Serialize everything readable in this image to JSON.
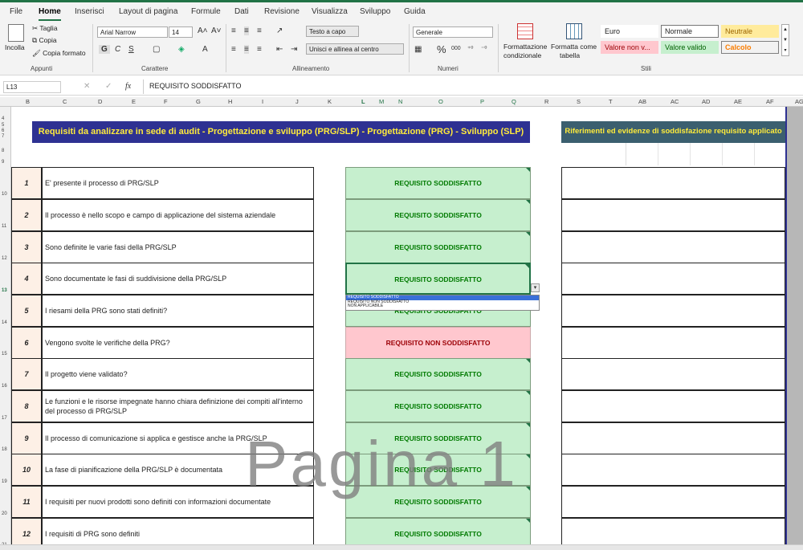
{
  "menu": [
    "File",
    "Home",
    "Inserisci",
    "Layout di pagina",
    "Formule",
    "Dati",
    "Revisione",
    "Visualizza",
    "Sviluppo",
    "Guida"
  ],
  "ribbon": {
    "paste": "Incolla",
    "cut": "Taglia",
    "copy": "Copia",
    "format_painter": "Copia formato",
    "group_clipboard": "Appunti",
    "font_name": "Arial Narrow",
    "font_size": "14",
    "bold": "G",
    "italic": "C",
    "underline": "S",
    "group_font": "Carattere",
    "wrap_text": "Testo a capo",
    "merge_center": "Unisci e allinea al centro",
    "group_alignment": "Allineamento",
    "number_format": "Generale",
    "group_number": "Numeri",
    "cond_format_1": "Formattazione",
    "cond_format_2": "condizionale",
    "format_table_1": "Formatta come",
    "format_table_2": "tabella",
    "styles": {
      "euro": "Euro",
      "normale": "Normale",
      "neutrale": "Neutrale",
      "non_valido": "Valore non v...",
      "valido": "Valore valido",
      "calcolo": "Calcolo"
    },
    "group_styles": "Stili"
  },
  "formula_bar": {
    "name_box": "L13",
    "fx": "fx",
    "value": "REQUISITO SODDISFATTO"
  },
  "columns": [
    "B",
    "C",
    "D",
    "E",
    "F",
    "G",
    "H",
    "I",
    "J",
    "K",
    "L",
    "M",
    "N",
    "O",
    "P",
    "Q",
    "R",
    "S",
    "T",
    "AB",
    "AC",
    "AD",
    "AE",
    "AF",
    "AG"
  ],
  "row_numbers": [
    "4",
    "5",
    "6",
    "7",
    "8",
    "9",
    "10",
    "11",
    "12",
    "13",
    "14",
    "15",
    "16",
    "17",
    "18",
    "19",
    "20",
    "21"
  ],
  "banner_left": "Requisiti da analizzare in sede di audit - Progettazione e sviluppo (PRG/SLP) - Progettazione (PRG) - Sviluppo (SLP)",
  "banner_right": "Riferimenti ed evidenze di soddisfazione requisito applicato",
  "rows": [
    {
      "n": "1",
      "q": "E' presente il processo di PRG/SLP",
      "s": "REQUISITO SODDISFATTO",
      "ok": true
    },
    {
      "n": "2",
      "q": "Il processo è nello scopo e campo di applicazione del sistema aziendale",
      "s": "REQUISITO SODDISFATTO",
      "ok": true
    },
    {
      "n": "3",
      "q": "Sono definite le varie fasi della PRG/SLP",
      "s": "REQUISITO SODDISFATTO",
      "ok": true
    },
    {
      "n": "4",
      "q": "Sono documentate le fasi di suddivisione della PRG/SLP",
      "s": "REQUISITO SODDISFATTO",
      "ok": true
    },
    {
      "n": "5",
      "q": "I riesami della PRG sono stati definiti?",
      "s": "REQUISITO SODDISFATTO",
      "ok": true
    },
    {
      "n": "6",
      "q": "Vengono svolte le verifiche della PRG?",
      "s": "REQUISITO NON SODDISFATTO",
      "ok": false
    },
    {
      "n": "7",
      "q": "Il progetto viene validato?",
      "s": "REQUISITO SODDISFATTO",
      "ok": true
    },
    {
      "n": "8",
      "q": "Le funzioni e le risorse impegnate hanno chiara definizione dei compiti all'interno del processo di PRG/SLP",
      "s": "REQUISITO SODDISFATTO",
      "ok": true
    },
    {
      "n": "9",
      "q": "Il processo di comunicazione si applica e gestisce anche la PRG/SLP",
      "s": "REQUISITO SODDISFATTO",
      "ok": true
    },
    {
      "n": "10",
      "q": "La fase di pianificazione della PRG/SLP è documentata",
      "s": "REQUISITO SODDISFATTO",
      "ok": true
    },
    {
      "n": "11",
      "q": "I requisiti per nuovi prodotti sono definiti con informazioni documentate",
      "s": "REQUISITO SODDISFATTO",
      "ok": true
    },
    {
      "n": "12",
      "q": "I requisiti di PRG sono definiti",
      "s": "REQUISITO SODDISFATTO",
      "ok": true
    }
  ],
  "dropdown": [
    "REQUISITO SODDISFATTO",
    "REQUISITO NON SODDISFATTO",
    "NON APPLICABILE"
  ],
  "watermark": "Pagina 1"
}
